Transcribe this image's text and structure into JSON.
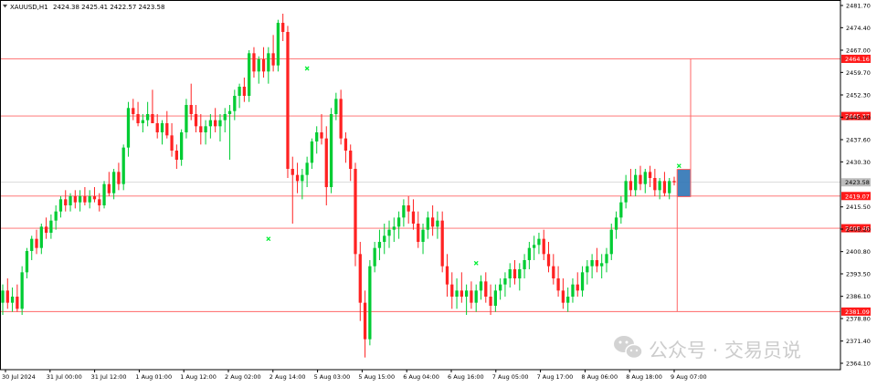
{
  "header": {
    "symbol": "XAUUSD,H1",
    "ohlc": "2424.38 2425.41 2422.57 2423.58",
    "dropdown_icon": "triangle-down-icon"
  },
  "watermark": {
    "icon": "wechat-icon",
    "text": "公众号 · 交易员说"
  },
  "colors": {
    "bull": "#00cc33",
    "bear": "#ff2222",
    "level_line": "#ff6666",
    "level_label_bg": "#ff1a1a",
    "price_label_bg": "#bdbdbd",
    "range_box_fill": "#2f74b5",
    "range_box_edge": "#ff3333",
    "marker": "#00ee33"
  },
  "chart_data": {
    "type": "candlestick",
    "title": "",
    "ylim": [
      2364.1,
      2481.7
    ],
    "y_ticks": [
      "2481.70",
      "2474.40",
      "2467.00",
      "2459.70",
      "2452.30",
      "2445.00",
      "2437.60",
      "2430.30",
      "2423.58",
      "2415.50",
      "2408.20",
      "2400.80",
      "2393.50",
      "2386.10",
      "2378.80",
      "2371.40",
      "2364.10"
    ],
    "x_ticks": [
      "30 Jul 2024",
      "31 Jul 00:00",
      "31 Jul 12:00",
      "1 Aug 01:00",
      "1 Aug 12:00",
      "2 Aug 02:00",
      "2 Aug 14:00",
      "5 Aug 03:00",
      "5 Aug 15:00",
      "6 Aug 04:00",
      "6 Aug 16:00",
      "7 Aug 05:00",
      "7 Aug 17:00",
      "8 Aug 06:00",
      "8 Aug 18:00",
      "9 Aug 07:00"
    ],
    "current_price": 2423.58,
    "horizontal_levels": [
      {
        "value": 2464.16,
        "label": "2464.16"
      },
      {
        "value": 2445.37,
        "label": "2445.37"
      },
      {
        "value": 2419.07,
        "label": "2419.07"
      },
      {
        "value": 2408.48,
        "label": "2408.48"
      },
      {
        "value": 2381.09,
        "label": "2381.09"
      }
    ],
    "range_box": {
      "high": 2427.8,
      "low": 2418.9
    },
    "candles": [
      {
        "o": 2384,
        "h": 2390,
        "l": 2380,
        "c": 2388
      },
      {
        "o": 2388,
        "h": 2392,
        "l": 2382,
        "c": 2384
      },
      {
        "o": 2384,
        "h": 2389,
        "l": 2381,
        "c": 2386
      },
      {
        "o": 2386,
        "h": 2390,
        "l": 2381,
        "c": 2382
      },
      {
        "o": 2382,
        "h": 2396,
        "l": 2380,
        "c": 2394
      },
      {
        "o": 2394,
        "h": 2402,
        "l": 2392,
        "c": 2401
      },
      {
        "o": 2401,
        "h": 2406,
        "l": 2398,
        "c": 2405
      },
      {
        "o": 2405,
        "h": 2408,
        "l": 2400,
        "c": 2402
      },
      {
        "o": 2402,
        "h": 2410,
        "l": 2400,
        "c": 2409
      },
      {
        "o": 2409,
        "h": 2412,
        "l": 2405,
        "c": 2407
      },
      {
        "o": 2407,
        "h": 2413,
        "l": 2405,
        "c": 2411
      },
      {
        "o": 2411,
        "h": 2416,
        "l": 2408,
        "c": 2414
      },
      {
        "o": 2414,
        "h": 2419,
        "l": 2412,
        "c": 2418
      },
      {
        "o": 2418,
        "h": 2421,
        "l": 2414,
        "c": 2416
      },
      {
        "o": 2416,
        "h": 2420,
        "l": 2414,
        "c": 2419
      },
      {
        "o": 2419,
        "h": 2421,
        "l": 2415,
        "c": 2417
      },
      {
        "o": 2417,
        "h": 2421,
        "l": 2414,
        "c": 2419
      },
      {
        "o": 2419,
        "h": 2422,
        "l": 2416,
        "c": 2417
      },
      {
        "o": 2417,
        "h": 2421,
        "l": 2415,
        "c": 2419
      },
      {
        "o": 2419,
        "h": 2422,
        "l": 2417,
        "c": 2418
      },
      {
        "o": 2418,
        "h": 2420,
        "l": 2414,
        "c": 2416
      },
      {
        "o": 2416,
        "h": 2424,
        "l": 2415,
        "c": 2423
      },
      {
        "o": 2423,
        "h": 2427,
        "l": 2419,
        "c": 2420
      },
      {
        "o": 2420,
        "h": 2428,
        "l": 2418,
        "c": 2427
      },
      {
        "o": 2427,
        "h": 2430,
        "l": 2421,
        "c": 2423
      },
      {
        "o": 2423,
        "h": 2436,
        "l": 2421,
        "c": 2435
      },
      {
        "o": 2435,
        "h": 2450,
        "l": 2432,
        "c": 2448
      },
      {
        "o": 2448,
        "h": 2451,
        "l": 2444,
        "c": 2446
      },
      {
        "o": 2446,
        "h": 2450,
        "l": 2442,
        "c": 2443
      },
      {
        "o": 2443,
        "h": 2446,
        "l": 2440,
        "c": 2444
      },
      {
        "o": 2444,
        "h": 2450,
        "l": 2442,
        "c": 2446
      },
      {
        "o": 2446,
        "h": 2454,
        "l": 2444,
        "c": 2443
      },
      {
        "o": 2443,
        "h": 2446,
        "l": 2438,
        "c": 2440
      },
      {
        "o": 2440,
        "h": 2444,
        "l": 2436,
        "c": 2443
      },
      {
        "o": 2443,
        "h": 2447,
        "l": 2438,
        "c": 2439
      },
      {
        "o": 2439,
        "h": 2443,
        "l": 2432,
        "c": 2434
      },
      {
        "o": 2434,
        "h": 2436,
        "l": 2428,
        "c": 2431
      },
      {
        "o": 2431,
        "h": 2441,
        "l": 2429,
        "c": 2440
      },
      {
        "o": 2440,
        "h": 2451,
        "l": 2438,
        "c": 2449
      },
      {
        "o": 2449,
        "h": 2456,
        "l": 2444,
        "c": 2446
      },
      {
        "o": 2446,
        "h": 2449,
        "l": 2440,
        "c": 2442
      },
      {
        "o": 2442,
        "h": 2446,
        "l": 2436,
        "c": 2440
      },
      {
        "o": 2440,
        "h": 2444,
        "l": 2436,
        "c": 2442
      },
      {
        "o": 2442,
        "h": 2446,
        "l": 2438,
        "c": 2444
      },
      {
        "o": 2444,
        "h": 2448,
        "l": 2440,
        "c": 2442
      },
      {
        "o": 2442,
        "h": 2446,
        "l": 2437,
        "c": 2444
      },
      {
        "o": 2444,
        "h": 2448,
        "l": 2440,
        "c": 2446
      },
      {
        "o": 2446,
        "h": 2449,
        "l": 2431,
        "c": 2447
      },
      {
        "o": 2447,
        "h": 2454,
        "l": 2444,
        "c": 2452
      },
      {
        "o": 2452,
        "h": 2456,
        "l": 2448,
        "c": 2455
      },
      {
        "o": 2455,
        "h": 2458,
        "l": 2450,
        "c": 2452
      },
      {
        "o": 2452,
        "h": 2467,
        "l": 2450,
        "c": 2466
      },
      {
        "o": 2466,
        "h": 2468,
        "l": 2458,
        "c": 2460
      },
      {
        "o": 2460,
        "h": 2465,
        "l": 2456,
        "c": 2464
      },
      {
        "o": 2464,
        "h": 2468,
        "l": 2458,
        "c": 2460
      },
      {
        "o": 2460,
        "h": 2468,
        "l": 2456,
        "c": 2466
      },
      {
        "o": 2466,
        "h": 2472,
        "l": 2460,
        "c": 2462
      },
      {
        "o": 2462,
        "h": 2477,
        "l": 2460,
        "c": 2476
      },
      {
        "o": 2476,
        "h": 2479,
        "l": 2470,
        "c": 2473
      },
      {
        "o": 2473,
        "h": 2475,
        "l": 2425,
        "c": 2428
      },
      {
        "o": 2428,
        "h": 2432,
        "l": 2410,
        "c": 2426
      },
      {
        "o": 2426,
        "h": 2430,
        "l": 2420,
        "c": 2424
      },
      {
        "o": 2424,
        "h": 2428,
        "l": 2418,
        "c": 2426
      },
      {
        "o": 2426,
        "h": 2432,
        "l": 2422,
        "c": 2430
      },
      {
        "o": 2430,
        "h": 2438,
        "l": 2428,
        "c": 2437
      },
      {
        "o": 2437,
        "h": 2442,
        "l": 2433,
        "c": 2440
      },
      {
        "o": 2440,
        "h": 2446,
        "l": 2436,
        "c": 2438
      },
      {
        "o": 2438,
        "h": 2442,
        "l": 2416,
        "c": 2422
      },
      {
        "o": 2422,
        "h": 2448,
        "l": 2420,
        "c": 2446
      },
      {
        "o": 2446,
        "h": 2453,
        "l": 2444,
        "c": 2451
      },
      {
        "o": 2451,
        "h": 2454,
        "l": 2436,
        "c": 2438
      },
      {
        "o": 2438,
        "h": 2440,
        "l": 2430,
        "c": 2434
      },
      {
        "o": 2434,
        "h": 2436,
        "l": 2424,
        "c": 2428
      },
      {
        "o": 2428,
        "h": 2430,
        "l": 2396,
        "c": 2400
      },
      {
        "o": 2400,
        "h": 2404,
        "l": 2378,
        "c": 2384
      },
      {
        "o": 2384,
        "h": 2388,
        "l": 2366,
        "c": 2372
      },
      {
        "o": 2372,
        "h": 2398,
        "l": 2370,
        "c": 2396
      },
      {
        "o": 2396,
        "h": 2404,
        "l": 2394,
        "c": 2402
      },
      {
        "o": 2402,
        "h": 2408,
        "l": 2398,
        "c": 2404
      },
      {
        "o": 2404,
        "h": 2410,
        "l": 2400,
        "c": 2406
      },
      {
        "o": 2406,
        "h": 2411,
        "l": 2402,
        "c": 2408
      },
      {
        "o": 2408,
        "h": 2412,
        "l": 2404,
        "c": 2409
      },
      {
        "o": 2409,
        "h": 2414,
        "l": 2405,
        "c": 2412
      },
      {
        "o": 2412,
        "h": 2418,
        "l": 2409,
        "c": 2416
      },
      {
        "o": 2416,
        "h": 2419,
        "l": 2410,
        "c": 2414
      },
      {
        "o": 2414,
        "h": 2418,
        "l": 2408,
        "c": 2410
      },
      {
        "o": 2410,
        "h": 2414,
        "l": 2402,
        "c": 2404
      },
      {
        "o": 2404,
        "h": 2410,
        "l": 2400,
        "c": 2408
      },
      {
        "o": 2408,
        "h": 2414,
        "l": 2405,
        "c": 2412
      },
      {
        "o": 2412,
        "h": 2416,
        "l": 2406,
        "c": 2409
      },
      {
        "o": 2409,
        "h": 2414,
        "l": 2405,
        "c": 2411
      },
      {
        "o": 2411,
        "h": 2414,
        "l": 2394,
        "c": 2396
      },
      {
        "o": 2396,
        "h": 2400,
        "l": 2386,
        "c": 2390
      },
      {
        "o": 2390,
        "h": 2394,
        "l": 2382,
        "c": 2386
      },
      {
        "o": 2386,
        "h": 2392,
        "l": 2382,
        "c": 2388
      },
      {
        "o": 2388,
        "h": 2394,
        "l": 2384,
        "c": 2386
      },
      {
        "o": 2386,
        "h": 2390,
        "l": 2380,
        "c": 2388
      },
      {
        "o": 2388,
        "h": 2391,
        "l": 2382,
        "c": 2384
      },
      {
        "o": 2384,
        "h": 2390,
        "l": 2381,
        "c": 2388
      },
      {
        "o": 2388,
        "h": 2393,
        "l": 2385,
        "c": 2391
      },
      {
        "o": 2391,
        "h": 2394,
        "l": 2384,
        "c": 2386
      },
      {
        "o": 2386,
        "h": 2390,
        "l": 2380,
        "c": 2383
      },
      {
        "o": 2383,
        "h": 2390,
        "l": 2381,
        "c": 2388
      },
      {
        "o": 2388,
        "h": 2392,
        "l": 2385,
        "c": 2390
      },
      {
        "o": 2390,
        "h": 2394,
        "l": 2386,
        "c": 2392
      },
      {
        "o": 2392,
        "h": 2397,
        "l": 2389,
        "c": 2395
      },
      {
        "o": 2395,
        "h": 2398,
        "l": 2390,
        "c": 2392
      },
      {
        "o": 2392,
        "h": 2397,
        "l": 2388,
        "c": 2395
      },
      {
        "o": 2395,
        "h": 2400,
        "l": 2392,
        "c": 2398
      },
      {
        "o": 2398,
        "h": 2404,
        "l": 2395,
        "c": 2402
      },
      {
        "o": 2402,
        "h": 2406,
        "l": 2398,
        "c": 2403
      },
      {
        "o": 2403,
        "h": 2407,
        "l": 2400,
        "c": 2405
      },
      {
        "o": 2405,
        "h": 2408,
        "l": 2398,
        "c": 2400
      },
      {
        "o": 2400,
        "h": 2404,
        "l": 2394,
        "c": 2396
      },
      {
        "o": 2396,
        "h": 2400,
        "l": 2390,
        "c": 2392
      },
      {
        "o": 2392,
        "h": 2396,
        "l": 2386,
        "c": 2388
      },
      {
        "o": 2388,
        "h": 2392,
        "l": 2382,
        "c": 2384
      },
      {
        "o": 2384,
        "h": 2389,
        "l": 2381,
        "c": 2386
      },
      {
        "o": 2386,
        "h": 2392,
        "l": 2384,
        "c": 2390
      },
      {
        "o": 2390,
        "h": 2394,
        "l": 2386,
        "c": 2388
      },
      {
        "o": 2388,
        "h": 2396,
        "l": 2386,
        "c": 2394
      },
      {
        "o": 2394,
        "h": 2398,
        "l": 2390,
        "c": 2396
      },
      {
        "o": 2396,
        "h": 2400,
        "l": 2392,
        "c": 2398
      },
      {
        "o": 2398,
        "h": 2402,
        "l": 2394,
        "c": 2396
      },
      {
        "o": 2396,
        "h": 2400,
        "l": 2392,
        "c": 2397
      },
      {
        "o": 2397,
        "h": 2402,
        "l": 2394,
        "c": 2400
      },
      {
        "o": 2400,
        "h": 2410,
        "l": 2398,
        "c": 2408
      },
      {
        "o": 2408,
        "h": 2414,
        "l": 2405,
        "c": 2412
      },
      {
        "o": 2412,
        "h": 2419,
        "l": 2410,
        "c": 2417
      },
      {
        "o": 2417,
        "h": 2426,
        "l": 2415,
        "c": 2424
      },
      {
        "o": 2424,
        "h": 2428,
        "l": 2419,
        "c": 2421
      },
      {
        "o": 2421,
        "h": 2428,
        "l": 2419,
        "c": 2426
      },
      {
        "o": 2426,
        "h": 2429,
        "l": 2421,
        "c": 2423
      },
      {
        "o": 2423,
        "h": 2428,
        "l": 2420,
        "c": 2427
      },
      {
        "o": 2427,
        "h": 2429,
        "l": 2422,
        "c": 2425
      },
      {
        "o": 2425,
        "h": 2428,
        "l": 2419,
        "c": 2421
      },
      {
        "o": 2421,
        "h": 2425,
        "l": 2418,
        "c": 2424
      },
      {
        "o": 2424,
        "h": 2427,
        "l": 2419,
        "c": 2420
      },
      {
        "o": 2420,
        "h": 2425,
        "l": 2418,
        "c": 2424
      },
      {
        "o": 2424,
        "h": 2425.41,
        "l": 2422.57,
        "c": 2423.58
      }
    ],
    "markers": [
      {
        "index": 63,
        "price": 2461
      },
      {
        "index": 55,
        "price": 2405
      },
      {
        "index": 98,
        "price": 2397
      },
      {
        "index": 140,
        "price": 2429
      }
    ]
  }
}
